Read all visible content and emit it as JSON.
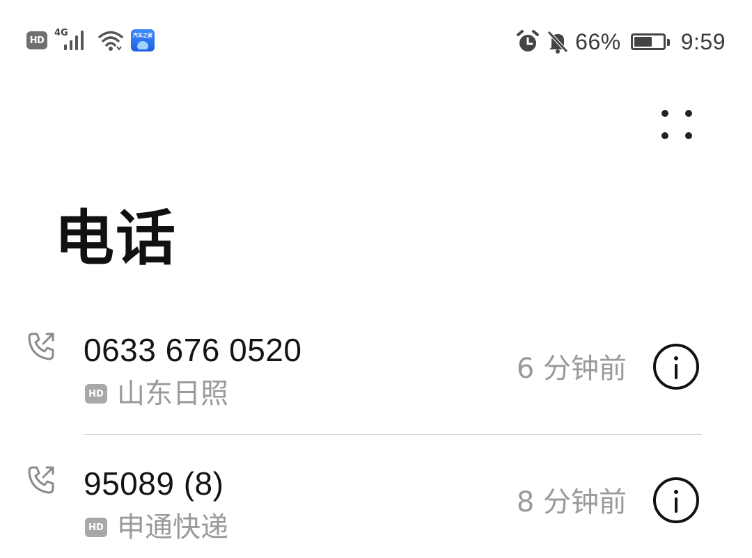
{
  "status_bar": {
    "hd_label": "HD",
    "network_label": "4G",
    "app_badge_label": "汽车之家",
    "battery_percent_text": "66%",
    "battery_level": 0.66,
    "time": "9:59",
    "icons": [
      "hd-icon",
      "signal-icon",
      "wifi-icon",
      "autohome-app-icon",
      "alarm-icon",
      "bell-off-icon",
      "battery-charging-icon"
    ]
  },
  "header": {
    "title": "电话",
    "more_icon": "more-dots-icon"
  },
  "calls": [
    {
      "number": "0633 676 0520",
      "hd_label": "HD",
      "location": "山东日照",
      "time_ago": "6 分钟前",
      "call_type_icon": "outgoing-call-icon",
      "info_icon": "info-icon"
    },
    {
      "number": "95089 (8)",
      "hd_label": "HD",
      "location": "申通快递",
      "time_ago": "8 分钟前",
      "call_type_icon": "outgoing-call-icon",
      "info_icon": "info-icon"
    }
  ],
  "colors": {
    "text_primary": "#141414",
    "text_secondary": "#9a9a9a",
    "divider": "#d9d9d9",
    "hd_badge": "#a8a8a8",
    "app_badge": "#2f74f0"
  }
}
